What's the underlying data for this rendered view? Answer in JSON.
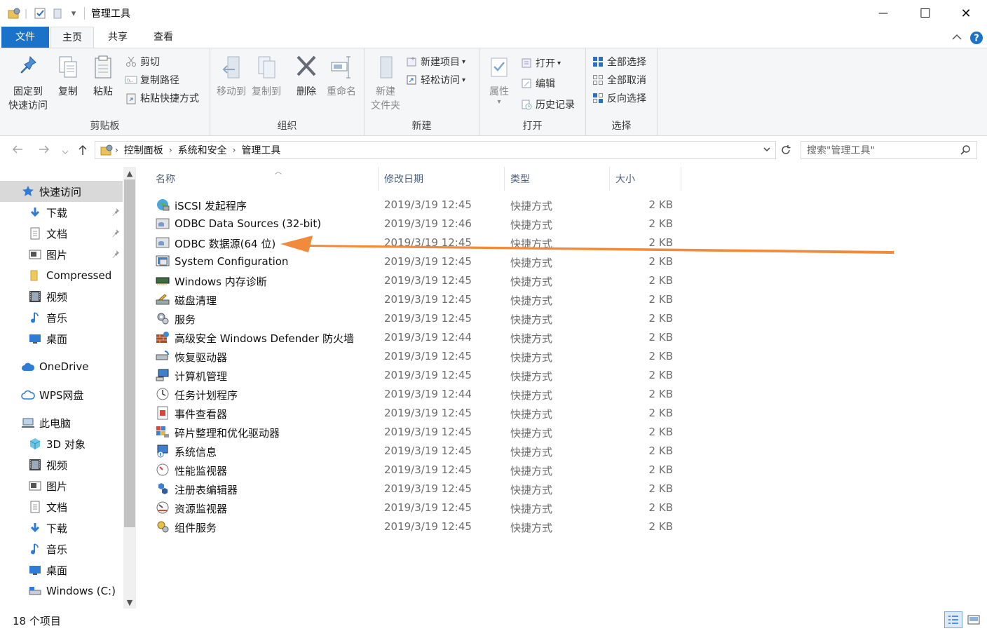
{
  "window": {
    "title": "管理工具",
    "minimize": "—",
    "maximize": "☐",
    "close": "✕"
  },
  "quick_access_toolbar": {
    "dropdown": "▾"
  },
  "tabs": [
    {
      "label": "文件"
    },
    {
      "label": "主页"
    },
    {
      "label": "共享"
    },
    {
      "label": "查看"
    }
  ],
  "ribbon": {
    "clipboard": {
      "label": "剪贴板",
      "pin": [
        "固定到",
        "快速访问"
      ],
      "copy": "复制",
      "paste": "粘贴",
      "cut": "剪切",
      "copy_path": "复制路径",
      "paste_shortcut": "粘贴快捷方式"
    },
    "organize": {
      "label": "组织",
      "move_to": "移动到",
      "copy_to": "复制到",
      "delete": "删除",
      "rename": "重命名"
    },
    "new": {
      "label": "新建",
      "new_folder": [
        "新建",
        "文件夹"
      ],
      "new_item": "新建项目",
      "easy_access": "轻松访问"
    },
    "open": {
      "label": "打开",
      "properties": "属性",
      "open": "打开",
      "edit": "编辑",
      "history": "历史记录"
    },
    "select": {
      "label": "选择",
      "select_all": "全部选择",
      "select_none": "全部取消",
      "invert": "反向选择"
    }
  },
  "address": {
    "crumbs": [
      "控制面板",
      "系统和安全",
      "管理工具"
    ],
    "search_placeholder": "搜索\"管理工具\""
  },
  "nav": [
    {
      "label": "快速访问",
      "icon": "star-icon",
      "level": 1,
      "selected": true,
      "pinned": false
    },
    {
      "label": "下载",
      "icon": "download-icon",
      "level": 2,
      "pinned": true
    },
    {
      "label": "文档",
      "icon": "document-icon",
      "level": 2,
      "pinned": true
    },
    {
      "label": "图片",
      "icon": "picture-icon",
      "level": 2,
      "pinned": true
    },
    {
      "label": "Compressed",
      "icon": "folder-icon",
      "level": 2,
      "pinned": false
    },
    {
      "label": "视频",
      "icon": "video-icon",
      "level": 2,
      "pinned": false
    },
    {
      "label": "音乐",
      "icon": "music-icon",
      "level": 2,
      "pinned": false
    },
    {
      "label": "桌面",
      "icon": "desktop-icon",
      "level": 2,
      "pinned": false
    },
    {
      "label": "OneDrive",
      "icon": "cloud-icon",
      "level": 1,
      "pinned": false
    },
    {
      "label": "WPS网盘",
      "icon": "wps-cloud-icon",
      "level": 1,
      "pinned": false
    },
    {
      "label": "此电脑",
      "icon": "computer-icon",
      "level": 1,
      "pinned": false
    },
    {
      "label": "3D 对象",
      "icon": "cube-icon",
      "level": 2,
      "pinned": false
    },
    {
      "label": "视频",
      "icon": "video-icon",
      "level": 2,
      "pinned": false
    },
    {
      "label": "图片",
      "icon": "picture-icon",
      "level": 2,
      "pinned": false
    },
    {
      "label": "文档",
      "icon": "document-icon",
      "level": 2,
      "pinned": false
    },
    {
      "label": "下载",
      "icon": "download-icon",
      "level": 2,
      "pinned": false
    },
    {
      "label": "音乐",
      "icon": "music-icon",
      "level": 2,
      "pinned": false
    },
    {
      "label": "桌面",
      "icon": "desktop-icon",
      "level": 2,
      "pinned": false
    },
    {
      "label": "Windows (C:)",
      "icon": "drive-icon",
      "level": 2,
      "pinned": false
    }
  ],
  "columns": [
    "名称",
    "修改日期",
    "类型",
    "大小"
  ],
  "files": [
    {
      "name": "iSCSI 发起程序",
      "date": "2019/3/19 12:45",
      "type": "快捷方式",
      "size": "2 KB",
      "icon": "globe-icon"
    },
    {
      "name": "ODBC Data Sources (32-bit)",
      "date": "2019/3/19 12:46",
      "type": "快捷方式",
      "size": "2 KB",
      "icon": "database-icon"
    },
    {
      "name": "ODBC 数据源(64 位)",
      "date": "2019/3/19 12:45",
      "type": "快捷方式",
      "size": "2 KB",
      "icon": "database-icon"
    },
    {
      "name": "System Configuration",
      "date": "2019/3/19 12:45",
      "type": "快捷方式",
      "size": "2 KB",
      "icon": "config-icon"
    },
    {
      "name": "Windows 内存诊断",
      "date": "2019/3/19 12:45",
      "type": "快捷方式",
      "size": "2 KB",
      "icon": "memory-icon"
    },
    {
      "name": "磁盘清理",
      "date": "2019/3/19 12:45",
      "type": "快捷方式",
      "size": "2 KB",
      "icon": "disk-cleanup-icon"
    },
    {
      "name": "服务",
      "date": "2019/3/19 12:45",
      "type": "快捷方式",
      "size": "2 KB",
      "icon": "gears-icon"
    },
    {
      "name": "高级安全 Windows Defender 防火墙",
      "date": "2019/3/19 12:44",
      "type": "快捷方式",
      "size": "2 KB",
      "icon": "firewall-icon"
    },
    {
      "name": "恢复驱动器",
      "date": "2019/3/19 12:45",
      "type": "快捷方式",
      "size": "2 KB",
      "icon": "recovery-drive-icon"
    },
    {
      "name": "计算机管理",
      "date": "2019/3/19 12:45",
      "type": "快捷方式",
      "size": "2 KB",
      "icon": "computer-management-icon"
    },
    {
      "name": "任务计划程序",
      "date": "2019/3/19 12:44",
      "type": "快捷方式",
      "size": "2 KB",
      "icon": "clock-icon"
    },
    {
      "name": "事件查看器",
      "date": "2019/3/19 12:45",
      "type": "快捷方式",
      "size": "2 KB",
      "icon": "event-viewer-icon"
    },
    {
      "name": "碎片整理和优化驱动器",
      "date": "2019/3/19 12:45",
      "type": "快捷方式",
      "size": "2 KB",
      "icon": "defrag-icon"
    },
    {
      "name": "系统信息",
      "date": "2019/3/19 12:45",
      "type": "快捷方式",
      "size": "2 KB",
      "icon": "system-info-icon"
    },
    {
      "name": "性能监视器",
      "date": "2019/3/19 12:45",
      "type": "快捷方式",
      "size": "2 KB",
      "icon": "performance-icon"
    },
    {
      "name": "注册表编辑器",
      "date": "2019/3/19 12:45",
      "type": "快捷方式",
      "size": "2 KB",
      "icon": "registry-icon"
    },
    {
      "name": "资源监视器",
      "date": "2019/3/19 12:45",
      "type": "快捷方式",
      "size": "2 KB",
      "icon": "resource-monitor-icon"
    },
    {
      "name": "组件服务",
      "date": "2019/3/19 12:45",
      "type": "快捷方式",
      "size": "2 KB",
      "icon": "component-services-icon"
    }
  ],
  "status": {
    "count": "18 个项目"
  },
  "colors": {
    "accent": "#1a73c8",
    "annotation_arrow": "#f28a3c",
    "selected_nav": "#d9d9d9"
  }
}
